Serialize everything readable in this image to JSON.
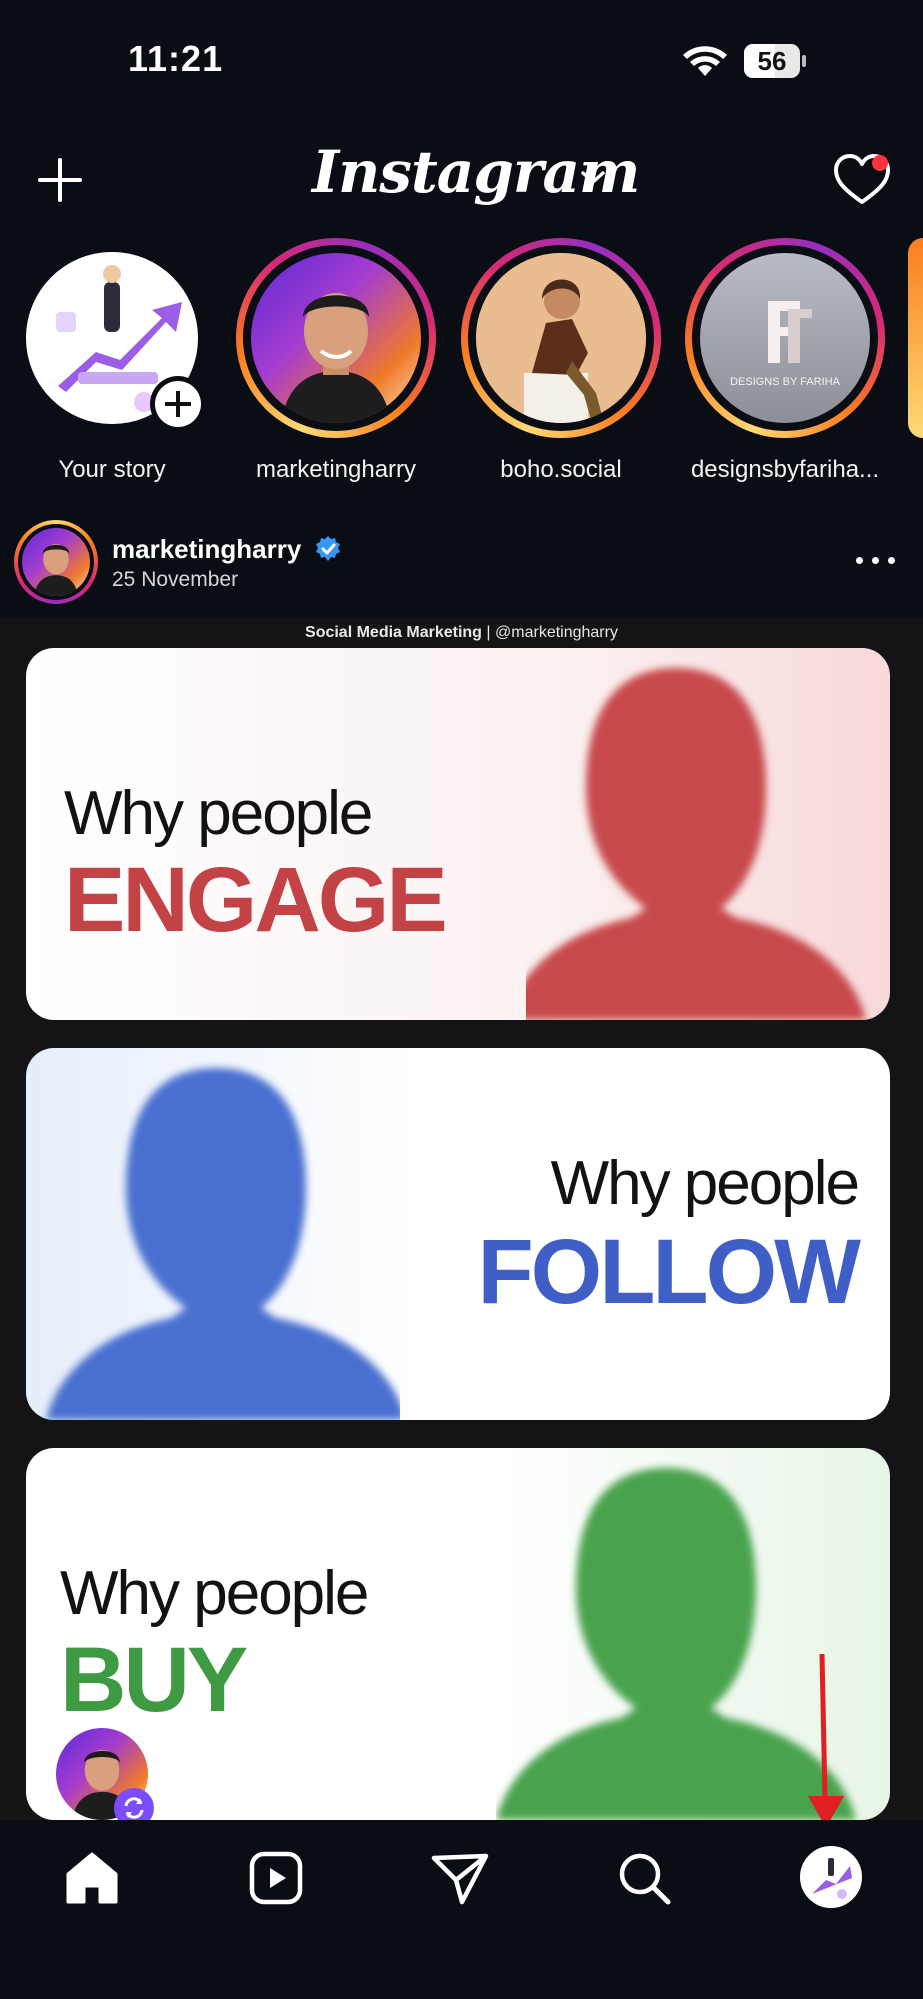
{
  "status_bar": {
    "time": "11:21",
    "battery": "56",
    "battery_level": 0.56
  },
  "header": {
    "logo": "Instagram",
    "notifications_unread": true
  },
  "stories": [
    {
      "name": "Your story",
      "own": true
    },
    {
      "name": "marketingharry"
    },
    {
      "name": "boho.social"
    },
    {
      "name": "designsbyfariha..."
    }
  ],
  "story_art": {
    "fariha_caption": "DESIGNS BY FARIHA"
  },
  "post": {
    "username": "marketingharry",
    "verified": true,
    "date": "25 November",
    "image": {
      "top_caption_bold": "Social Media Marketing",
      "top_caption_sep": "|",
      "top_caption_handle": "@marketingharry",
      "cards": [
        {
          "line1": "Why people",
          "line2": "ENGAGE",
          "color": "#c24245"
        },
        {
          "line1": "Why people",
          "line2": "FOLLOW",
          "color": "#3f5fc6"
        },
        {
          "line1": "Why people",
          "line2": "BUY",
          "color": "#3f9b43"
        }
      ]
    }
  },
  "nav": {
    "items": [
      "home-icon",
      "reels-icon",
      "messages-icon",
      "search-icon",
      "profile-avatar"
    ],
    "active": "home-icon"
  },
  "colors": {
    "background": "#0b0d14",
    "notification": "#ff3040",
    "verified": "#3797f0",
    "annotation_arrow": "#e02020"
  }
}
